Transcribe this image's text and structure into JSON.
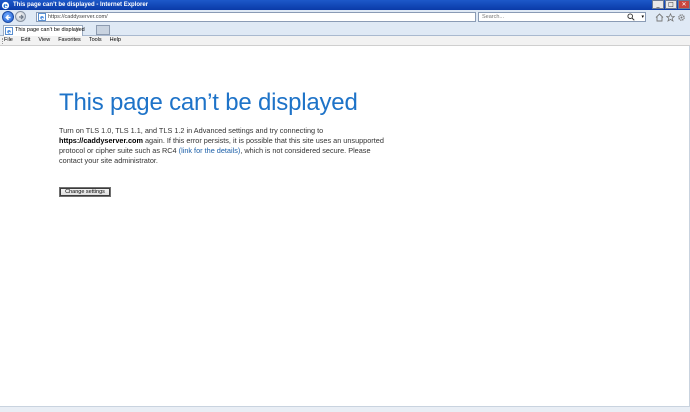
{
  "window": {
    "title": "This page can’t be displayed - Internet Explorer",
    "controls": [
      "minimize",
      "maximize",
      "close"
    ]
  },
  "address_bar": {
    "url": "https://caddyserver.com/",
    "refresh_icon": "refresh-icon",
    "dropdown_icon": "chevron-down-icon"
  },
  "search": {
    "placeholder": "Search...",
    "icon": "search-icon"
  },
  "toolbar_icons": [
    "home-icon",
    "favorites-star-icon",
    "gear-icon"
  ],
  "tabs": [
    {
      "label": "This page can’t be displayed",
      "active": true
    }
  ],
  "menu": {
    "items": [
      "File",
      "Edit",
      "View",
      "Favorites",
      "Tools",
      "Help"
    ]
  },
  "error_page": {
    "title": "This page can’t be displayed",
    "body_part1": "Turn on TLS 1.0, TLS 1.1, and TLS 1.2 in Advanced settings and try connecting to",
    "host": "https://caddyserver.com",
    "body_part2": "again. If this error persists, it is possible that this site uses an unsupported protocol or cipher suite such as RC4",
    "link_text": "(link for the details)",
    "body_part3": ", which is not considered secure. Please contact your site administrator.",
    "button_label": "Change settings"
  },
  "colors": {
    "title_bar": "#0a3aa8",
    "error_title": "#1e73c8",
    "link": "#1a5ea8",
    "chrome_background": "#dfe9f5"
  }
}
